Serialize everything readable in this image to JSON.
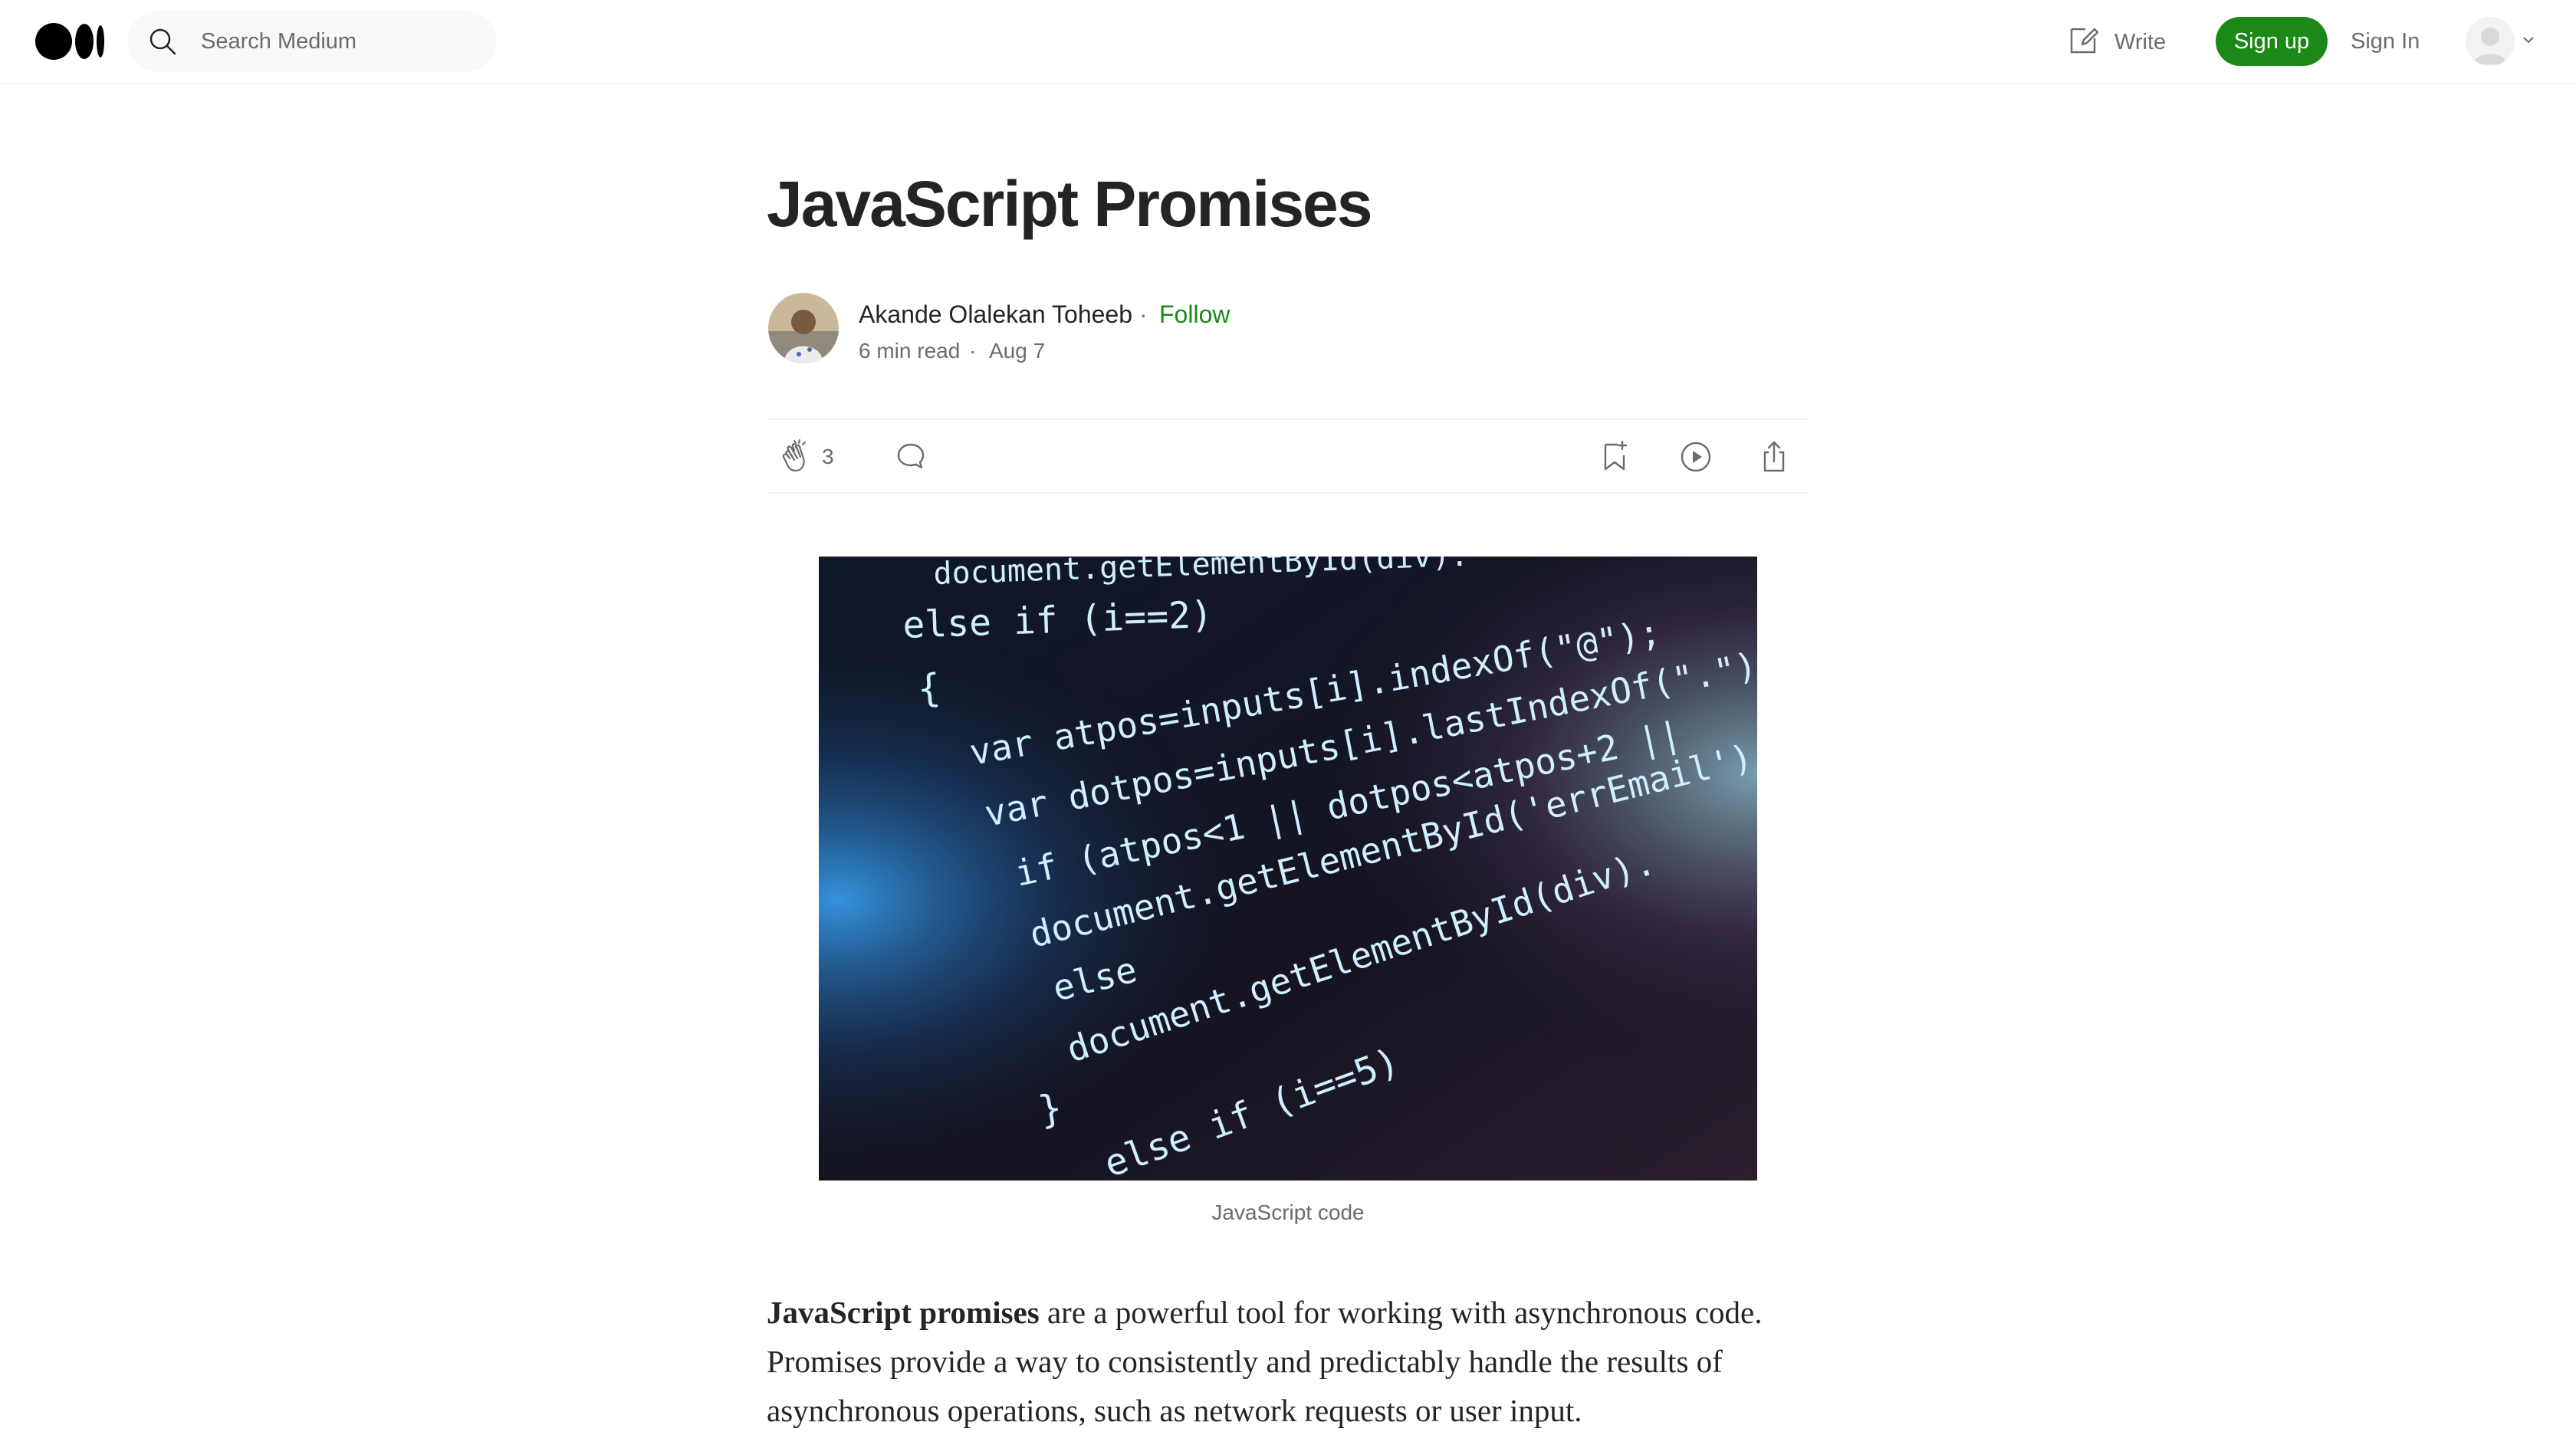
{
  "header": {
    "search_placeholder": "Search Medium",
    "write_label": "Write",
    "signup_label": "Sign up",
    "signin_label": "Sign In"
  },
  "article": {
    "title": "JavaScript Promises",
    "author_name": "Akande Olalekan Toheeb",
    "separator": "·",
    "follow_label": "Follow",
    "read_time": "6 min read",
    "date": "Aug 7",
    "clap_count": "3",
    "image_caption": "JavaScript code",
    "intro_bold": "JavaScript promises",
    "intro_rest": " are a powerful tool for working with asynchronous code. Promises provide a way to consistently and predictably handle the results of asynchronous operations, such as network requests or user input."
  },
  "image_code_lines": [
    "document.getElementById(div).",
    "else if (i==2)",
    "{",
    "var atpos=inputs[i].indexOf(\"@\");",
    "var dotpos=inputs[i].lastIndexOf(\".\");",
    "if (atpos<1 || dotpos<atpos+2 ||",
    "document.getElementById('errEmail').",
    "else",
    "document.getElementById(div).",
    "}",
    "else if (i==5)"
  ],
  "colors": {
    "brand_green": "#1a8917",
    "text_primary": "#242424",
    "text_secondary": "#6b6b6b",
    "divider": "#f2f2f2",
    "search_bg": "#f9f9f9"
  },
  "icons": {
    "logo": "medium-logo",
    "search": "search-icon",
    "write": "write-icon",
    "clap": "clap-icon",
    "comment": "comment-icon",
    "bookmark": "bookmark-add-icon",
    "listen": "play-icon",
    "share": "share-icon"
  }
}
